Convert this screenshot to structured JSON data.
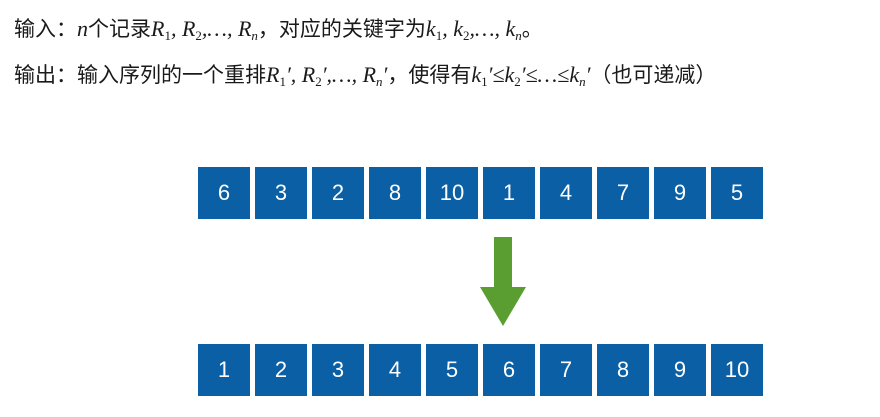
{
  "input_line": {
    "label": "输入：",
    "n": "n",
    "text1": "个记录",
    "R1": "R",
    "R1_sub": "1",
    "comma1": ", ",
    "R2": "R",
    "R2_sub": "2",
    "sep1": ",…, ",
    "Rn": "R",
    "Rn_sub": "n",
    "text2": "，对应的关键字为",
    "k1": "k",
    "k1_sub": "1",
    "comma2": ", ",
    "k2": "k",
    "k2_sub": "2",
    "sep2": ",…, ",
    "kn": "k",
    "kn_sub": "n",
    "end": "。"
  },
  "output_line": {
    "label": "输出：",
    "text1": "输入序列的一个重排",
    "R1": "R",
    "R1_sub": "1",
    "prime1": "′, ",
    "R2": "R",
    "R2_sub": "2",
    "prime2": "′,…, ",
    "Rn": "R",
    "Rn_sub": "n",
    "prime3": "′",
    "text2": "，使得有",
    "k1": "k",
    "k1_sub": "1",
    "le1": "′≤",
    "k2": "k",
    "k2_sub": "2",
    "le2": "′≤…≤",
    "kn": "k",
    "kn_sub": "n",
    "prime4": "′",
    "note": "（也可递减）"
  },
  "before_values": [
    "6",
    "3",
    "2",
    "8",
    "10",
    "1",
    "4",
    "7",
    "9",
    "5"
  ],
  "after_values": [
    "1",
    "2",
    "3",
    "4",
    "5",
    "6",
    "7",
    "8",
    "9",
    "10"
  ],
  "colors": {
    "cell_fill": "#0a5fa5",
    "cell_text": "#ffffff",
    "arrow": "#5a9e31"
  },
  "icons": {
    "arrow": "down-arrow-icon"
  }
}
